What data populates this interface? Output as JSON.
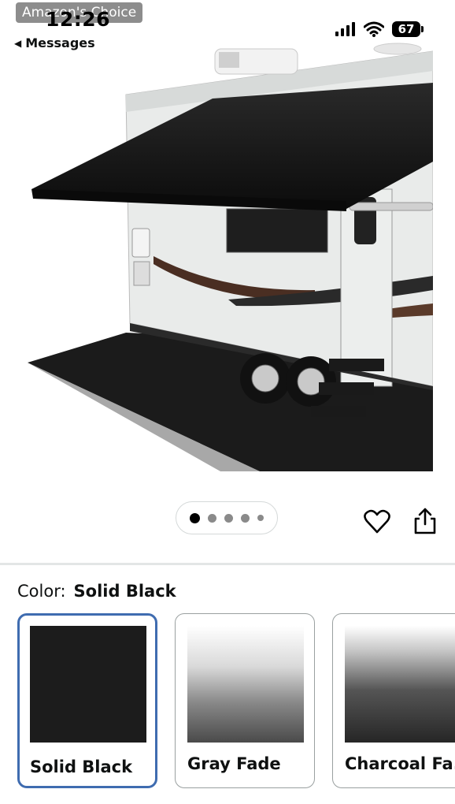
{
  "status_bar": {
    "time": "12:26",
    "back_label": "Messages",
    "battery": "67"
  },
  "badge": "Amazon's Choice",
  "product": {
    "image_icon": "rv-awning-image",
    "carousel": {
      "total_images": 5,
      "active_index": 0
    }
  },
  "color": {
    "label": "Color:",
    "selected": "Solid Black"
  },
  "swatches": [
    {
      "name": "Solid Black",
      "selected": true,
      "swatch_color": "#1c1c1c"
    },
    {
      "name": "Gray Fade",
      "selected": false,
      "swatch_color": "#5e5e5e"
    },
    {
      "name": "Charcoal Fa...",
      "selected": false,
      "swatch_color": "#2f2f2f"
    }
  ],
  "colors": {
    "accent": "#3f6cb0",
    "divider": "#e3e6e6",
    "text": "#0f1111"
  }
}
